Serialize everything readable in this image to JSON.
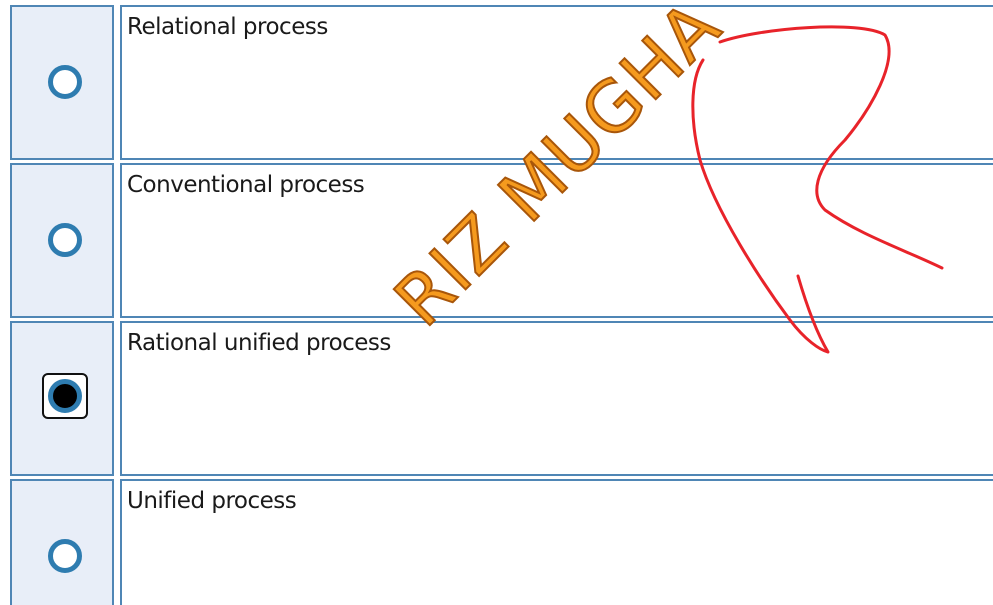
{
  "question": {
    "options": [
      {
        "label": "Relational process",
        "selected": false
      },
      {
        "label": "Conventional process",
        "selected": false
      },
      {
        "label": "Rational unified process",
        "selected": true
      },
      {
        "label": "Unified process",
        "selected": false
      }
    ]
  },
  "watermark": {
    "text": "RIZ MUGHA"
  },
  "colors": {
    "border": "#4f86b5",
    "radio_cell_bg": "#e8eef8",
    "radio_ring": "#2e7cb0",
    "watermark_fill": "#f59a1e",
    "annotation_stroke": "#e8232a"
  }
}
